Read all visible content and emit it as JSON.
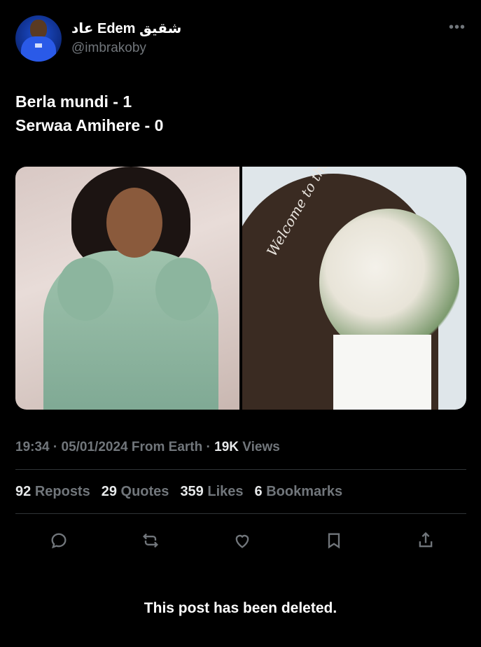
{
  "author": {
    "display_name": "عاد Edem شقيق",
    "handle": "@imbrakoby"
  },
  "more_label": "•••",
  "tweet": {
    "line1": "Berla mundi - 1",
    "line2": "Serwaa Amihere - 0"
  },
  "media": {
    "right_photo_text": "Welcome to the Wedding of"
  },
  "meta": {
    "time": "19:34",
    "date": "05/01/2024",
    "source": "From Earth",
    "views_count": "19K",
    "views_label": "Views"
  },
  "stats": {
    "reposts": {
      "num": "92",
      "label": "Reposts"
    },
    "quotes": {
      "num": "29",
      "label": "Quotes"
    },
    "likes": {
      "num": "359",
      "label": "Likes"
    },
    "bookmarks": {
      "num": "6",
      "label": "Bookmarks"
    }
  },
  "actions": [
    "reply-icon",
    "repost-icon",
    "like-icon",
    "bookmark-icon",
    "share-icon"
  ],
  "notice": "This post has been deleted."
}
